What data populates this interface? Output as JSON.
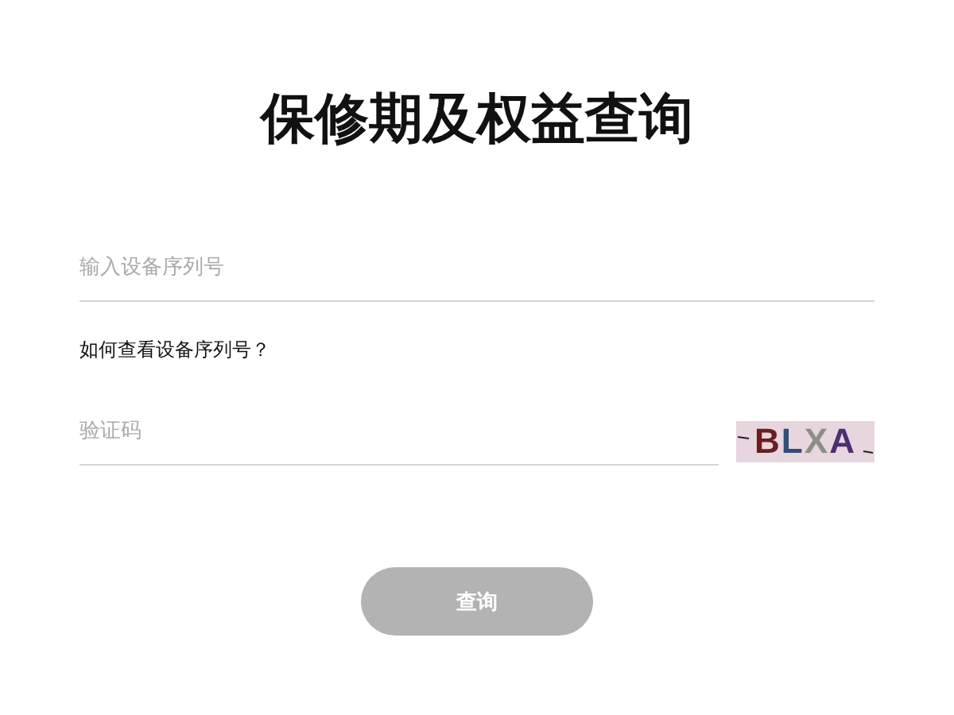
{
  "title": "保修期及权益查询",
  "serial_field": {
    "placeholder": "输入设备序列号"
  },
  "help_link": "如何查看设备序列号？",
  "captcha_field": {
    "placeholder": "验证码"
  },
  "captcha": {
    "text": "BLXA"
  },
  "submit_button": {
    "label": "查询",
    "disabled": true
  }
}
